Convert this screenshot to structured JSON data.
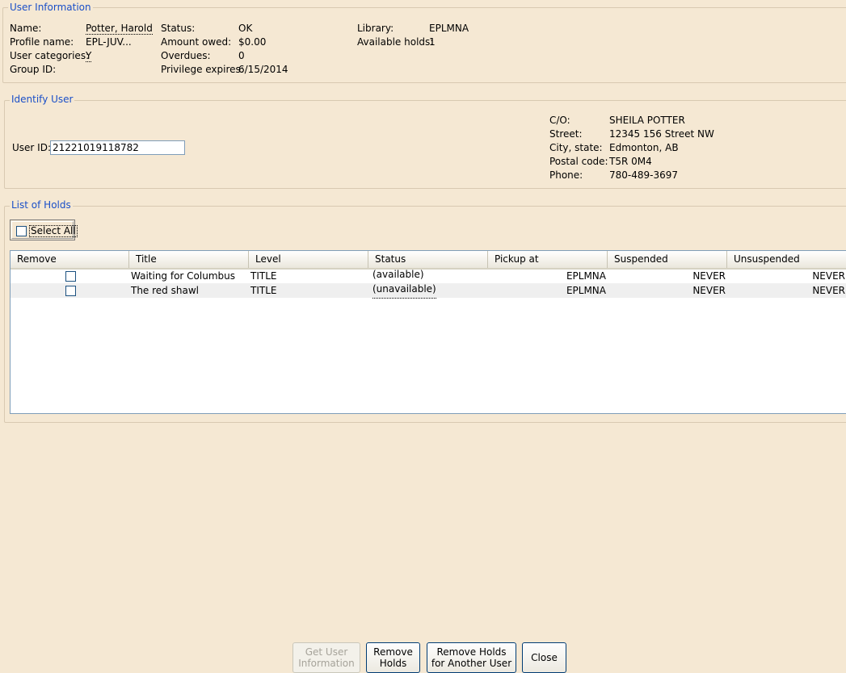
{
  "user_info": {
    "legend": "User Information",
    "name_label": "Name:",
    "name_value": "Potter, Harold",
    "profile_label": "Profile name:",
    "profile_value": "EPL-JUV...",
    "categories_label": "User categories:",
    "categories_value": "Y",
    "group_label": "Group ID:",
    "status_label": "Status:",
    "status_value": "OK",
    "owed_label": "Amount owed:",
    "owed_value": "$0.00",
    "overdues_label": "Overdues:",
    "overdues_value": "0",
    "privilege_label": "Privilege expires:",
    "privilege_value": "6/15/2014",
    "library_label": "Library:",
    "library_value": "EPLMNA",
    "holds_label": "Available holds:",
    "holds_value": "1"
  },
  "identify": {
    "legend": "Identify User",
    "user_id_label": "User ID:",
    "user_id_value": "21221019118782",
    "co_label": "C/O:",
    "co_value": "SHEILA POTTER",
    "street_label": "Street:",
    "street_value": "12345 156 Street NW",
    "city_label": "City, state:",
    "city_value": "Edmonton, AB",
    "postal_label": "Postal code:",
    "postal_value": "T5R 0M4",
    "phone_label": "Phone:",
    "phone_value": "780-489-3697"
  },
  "holds": {
    "legend": "List of Holds",
    "select_all": "Select All",
    "columns": [
      "Remove",
      "Title",
      "Level",
      "Status",
      "Pickup at",
      "Suspended",
      "Unsuspended"
    ],
    "rows": [
      {
        "title": "Waiting for Columbus",
        "level": "TITLE",
        "status": "(available)",
        "pickup": "EPLMNA",
        "suspended": "NEVER",
        "unsuspended": "NEVER"
      },
      {
        "title": "The red shawl",
        "level": "TITLE",
        "status": "(unavailable)",
        "pickup": "EPLMNA",
        "suspended": "NEVER",
        "unsuspended": "NEVER"
      }
    ]
  },
  "buttons": {
    "get_info_1": "Get User",
    "get_info_2": "Information",
    "remove_1": "Remove",
    "remove_2": "Holds",
    "another_1": "Remove Holds",
    "another_2": "for Another User",
    "close": "Close"
  }
}
